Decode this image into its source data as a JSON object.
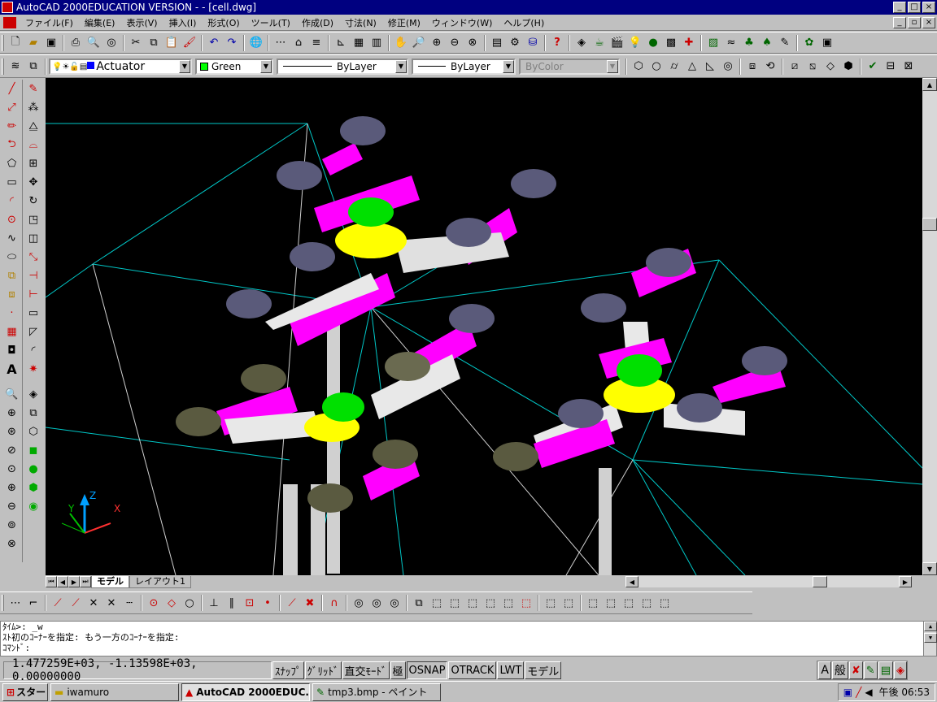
{
  "window": {
    "title": "AutoCAD 2000EDUCATION VERSION - - [cell.dwg]",
    "controls": [
      "_",
      "□",
      "×"
    ]
  },
  "menu": {
    "items": [
      "ファイル(F)",
      "編集(E)",
      "表示(V)",
      "挿入(I)",
      "形式(O)",
      "ツール(T)",
      "作成(D)",
      "寸法(N)",
      "修正(M)",
      "ウィンドウ(W)",
      "ヘルプ(H)"
    ]
  },
  "properties": {
    "layer": "Actuator",
    "color": "Green",
    "linetype": "ByLayer",
    "lineweight": "ByLayer",
    "plotstyle": "ByColor"
  },
  "colors": {
    "accent_title": "#000080",
    "viewport_bg": "#000000",
    "magenta": "#ff00ff",
    "yellow": "#ffff00",
    "green": "#00ff00",
    "cyan": "#00c8c8",
    "pad": "#5a5a7a",
    "pad_olive": "#5a5a40"
  },
  "tabs": {
    "model": "モデル",
    "layout1": "レイアウト1"
  },
  "command": {
    "line1": "ﾀｲﾑ>:  _w",
    "line2": " ｽﾄ初のｺｰﾅｰを指定: もう一方のｺｰﾅｰを指定:",
    "prompt": "ｺﾏﾝﾄﾞ:"
  },
  "status": {
    "coords": "1.477259E+03, -1.13598E+03, 0.00000000",
    "buttons": [
      "ｽﾅｯﾌﾟ",
      "ｸﾞﾘｯﾄﾞ",
      "直交ﾓｰﾄﾞ",
      "極",
      "OSNAP",
      "OTRACK",
      "LWT",
      "モデル"
    ],
    "ime": [
      "A",
      "般"
    ]
  },
  "taskbar": {
    "start": "スタート",
    "tasks": [
      "iwamuro",
      "AutoCAD 2000EDUC...",
      "tmp3.bmp - ペイント"
    ],
    "clock": "午後 06:53"
  },
  "ucs": {
    "x": "X",
    "y": "Y",
    "z": "Z"
  }
}
